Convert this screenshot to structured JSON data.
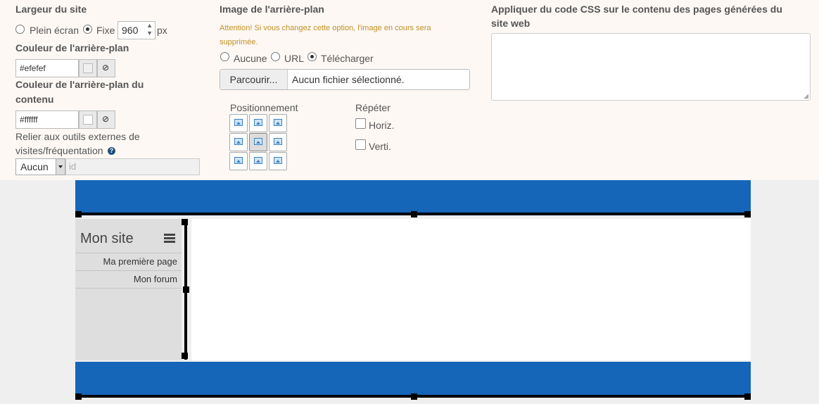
{
  "col1": {
    "site_width_label": "Largeur du site",
    "fullscreen_label": "Plein écran",
    "fixed_label": "Fixe",
    "width_value": "960",
    "width_unit": "px",
    "bg_color_label": "Couleur de l'arrière-plan",
    "bg_color_value": "#efefef",
    "content_bg_label_line1": "Couleur de l'arrière-plan du",
    "content_bg_label_line2": "contenu",
    "content_bg_value": "#ffffff",
    "external_tools_line1": "Relier aux outils externes de",
    "external_tools_line2": "visites/fréquentation",
    "help_glyph": "?",
    "tool_select_value": "Aucun",
    "tool_id_placeholder": "id"
  },
  "col2": {
    "bg_image_label": "Image de l'arrière-plan",
    "warning_line1": "Attention! Si vous changez cette option, l'image en cours sera",
    "warning_line2": "supprimée.",
    "opt_none": "Aucune",
    "opt_url": "URL",
    "opt_upload": "Télécharger",
    "browse_button": "Parcourir...",
    "file_status": "Aucun fichier sélectionné.",
    "positioning_label": "Positionnement",
    "repeat_label": "Répéter",
    "repeat_h": "Horiz.",
    "repeat_v": "Verti."
  },
  "col3": {
    "css_label_line1": "Appliquer du code CSS sur le contenu des pages générées du",
    "css_label_line2": "site web"
  },
  "preview": {
    "site_title": "Mon site",
    "menu_items": [
      "Ma première page",
      "Mon forum"
    ]
  },
  "colors": {
    "accent_blue": "#1565b9",
    "warning": "#c29023",
    "top_panel_bg": "#fdf8f4",
    "preview_bg": "#efefef"
  },
  "icons": {
    "clear": "ban-icon",
    "menu": "hamburger-icon",
    "position_cell": "image-icon"
  }
}
